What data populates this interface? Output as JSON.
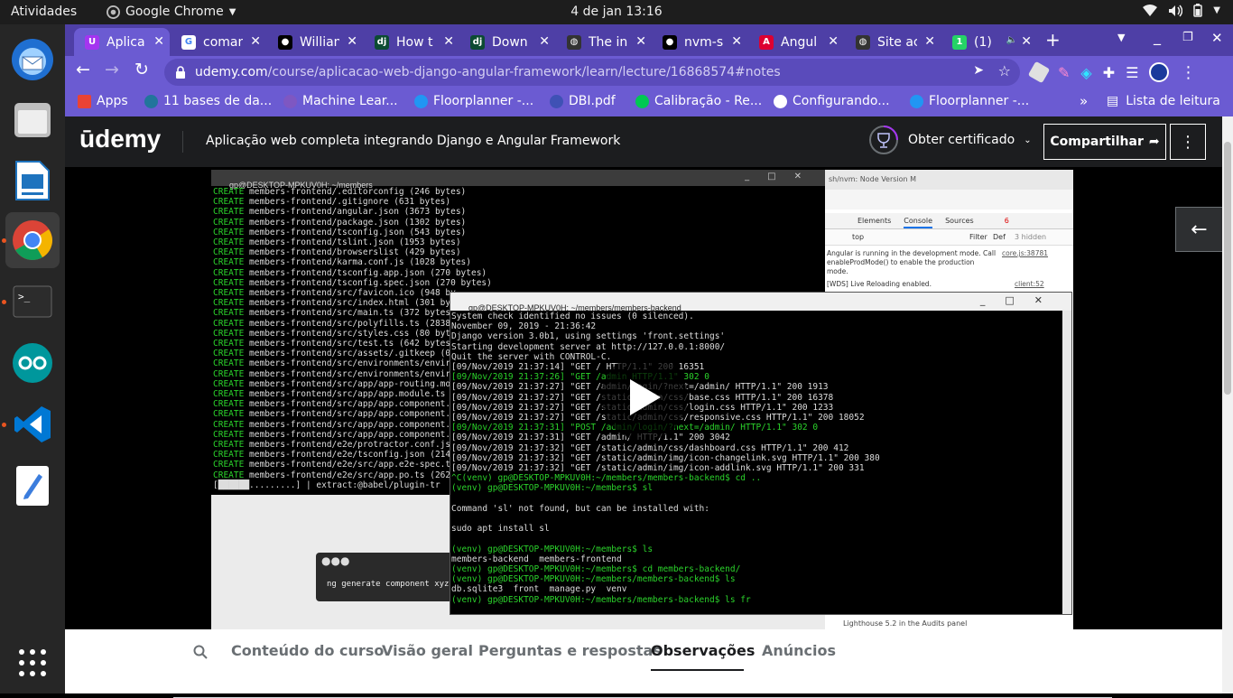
{
  "topbar": {
    "activities": "Atividades",
    "app_name": "Google Chrome",
    "clock": "4 de jan  13:16"
  },
  "tabs": [
    {
      "title": "Aplica",
      "color": "#a435f0",
      "glyph": "U"
    },
    {
      "title": "coman",
      "color": "#ffffff",
      "glyph": "G"
    },
    {
      "title": "Willian",
      "color": "#000000",
      "glyph": "●"
    },
    {
      "title": "How t",
      "color": "#0c4b33",
      "glyph": "dj"
    },
    {
      "title": "Down",
      "color": "#0c4b33",
      "glyph": "dj"
    },
    {
      "title": "The in",
      "color": "#333333",
      "glyph": "◍"
    },
    {
      "title": "nvm-s",
      "color": "#000000",
      "glyph": "●"
    },
    {
      "title": "Angul",
      "color": "#dd0031",
      "glyph": "A"
    },
    {
      "title": "Site ac",
      "color": "#333333",
      "glyph": "◍"
    },
    {
      "title": "(1)",
      "color": "#25d366",
      "glyph": "1"
    }
  ],
  "address": {
    "host": "udemy.com",
    "path": "/course/aplicacao-web-django-angular-framework/learn/lecture/16868574#notes"
  },
  "bookmarks": [
    {
      "label": "Apps",
      "color": "#ea4335"
    },
    {
      "label": "11 bases de da...",
      "color": "#21759b"
    },
    {
      "label": "Machine Lear...",
      "color": "#7e57c2"
    },
    {
      "label": "Floorplanner -...",
      "color": "#2196f3"
    },
    {
      "label": "DBI.pdf",
      "color": "#3f51b5"
    },
    {
      "label": "Calibração - Re...",
      "color": "#00c853"
    },
    {
      "label": "Configurando...",
      "color": "#ffffff"
    },
    {
      "label": "Floorplanner -...",
      "color": "#2196f3"
    }
  ],
  "reading_list": "Lista de leitura",
  "udemy": {
    "logo": "ūdemy",
    "course_title": "Aplicação web completa integrando Django e Angular Framework",
    "certificate": "Obter certificado",
    "share": "Compartilhar"
  },
  "video": {
    "term1_title": "gp@DESKTOP-MPKUV0H: ~/members",
    "term1_lines": [
      "members-frontend/.editorconfig (246 bytes)",
      "members-frontend/.gitignore (631 bytes)",
      "members-frontend/angular.json (3673 bytes)",
      "members-frontend/package.json (1302 bytes)",
      "members-frontend/tsconfig.json (543 bytes)",
      "members-frontend/tslint.json (1953 bytes)",
      "members-frontend/browserslist (429 bytes)",
      "members-frontend/karma.conf.js (1028 bytes)",
      "members-frontend/tsconfig.app.json (270 bytes)",
      "members-frontend/tsconfig.spec.json (270 bytes)",
      "members-frontend/src/favicon.ico (948 by",
      "members-frontend/src/index.html (301 byt",
      "members-frontend/src/main.ts (372 bytes)",
      "members-frontend/src/polyfills.ts (2838",
      "members-frontend/src/styles.css (80 byte",
      "members-frontend/src/test.ts (642 bytes)",
      "members-frontend/src/assets/.gitkeep (0",
      "members-frontend/src/environments/enviro",
      "members-frontend/src/environments/enviro",
      "members-frontend/src/app/app-routing.mod",
      "members-frontend/src/app/app.module.ts (",
      "members-frontend/src/app/app.component.c",
      "members-frontend/src/app/app.component.h",
      "members-frontend/src/app/app.component.s",
      "members-frontend/src/app/app.component.t",
      "members-frontend/e2e/protractor.conf.js",
      "members-frontend/e2e/tsconfig.json (214",
      "members-frontend/e2e/src/app.e2e-spec.ts",
      "members-frontend/e2e/src/app.po.ts (262"
    ],
    "term1_progress": "[██████.........] | extract:@babel/plugin-tr",
    "create_word": "CREATE",
    "term2_title": "gp@DESKTOP-MPKUV0H: ~/members/members-backend",
    "term2_lines": [
      "System check identified no issues (0 silenced).",
      "November 09, 2019 - 21:36:42",
      "Django version 3.0b1, using settings 'front.settings'",
      "Starting development server at http://127.0.0.1:8000/",
      "Quit the server with CONTROL-C.",
      "[09/Nov/2019 21:37:14] \"GET / HTTP/1.1\" 200 16351",
      "[09/Nov/2019 21:37:26] \"GET /admin HTTP/1.1\" 302 0",
      "[09/Nov/2019 21:37:27] \"GET /admin/login/?next=/admin/ HTTP/1.1\" 200 1913",
      "[09/Nov/2019 21:37:27] \"GET /static/admin/css/base.css HTTP/1.1\" 200 16378",
      "[09/Nov/2019 21:37:27] \"GET /static/admin/css/login.css HTTP/1.1\" 200 1233",
      "[09/Nov/2019 21:37:27] \"GET /static/admin/css/responsive.css HTTP/1.1\" 200 18052",
      "[09/Nov/2019 21:37:31] \"POST /admin/login/?next=/admin/ HTTP/1.1\" 302 0",
      "[09/Nov/2019 21:37:31] \"GET /admin/ HTTP/1.1\" 200 3042",
      "[09/Nov/2019 21:37:32] \"GET /static/admin/css/dashboard.css HTTP/1.1\" 200 412",
      "[09/Nov/2019 21:37:32] \"GET /static/admin/img/icon-changelink.svg HTTP/1.1\" 200 380",
      "[09/Nov/2019 21:37:32] \"GET /static/admin/img/icon-addlink.svg HTTP/1.1\" 200 331"
    ],
    "term2_cmds": [
      "^C(venv) gp@DESKTOP-MPKUV0H:~/members/members-backend$ cd ..",
      "(venv) gp@DESKTOP-MPKUV0H:~/members$ sl",
      "",
      "Command 'sl' not found, but can be installed with:",
      "",
      "sudo apt install sl",
      "",
      "(venv) gp@DESKTOP-MPKUV0H:~/members$ ls",
      "members-backend  members-frontend",
      "(venv) gp@DESKTOP-MPKUV0H:~/members$ cd members-backend/",
      "(venv) gp@DESKTOP-MPKUV0H:~/members/members-backend$ ls",
      "db.sqlite3  front  manage.py  venv",
      "(venv) gp@DESKTOP-MPKUV0H:~/members/members-backend$ ls fr"
    ],
    "ng_command": "ng generate component xyz",
    "devtools_title": "sh/nvm: Node Version M",
    "devtools_tabs": [
      "Elements",
      "Console",
      "Sources"
    ],
    "devtools_top": "top",
    "devtools_filter": "Filter",
    "devtools_def": "Def",
    "devtools_hidden": "3 hidden",
    "devtools_error_count": "6",
    "devtools_msg1": "Angular is running in the development mode. Call enableProdMode() to enable the production mode.",
    "devtools_src1": "core.js:38781",
    "devtools_msg2": "[WDS] Live Reloading enabled.",
    "devtools_src2": "client:52",
    "devtools_footer": "Lighthouse 5.2 in the Audits panel"
  },
  "page_tabs": [
    "Conteúdo do curso",
    "Visão geral",
    "Perguntas e respostas",
    "Observações",
    "Anúncios"
  ],
  "active_page_tab": "Observações"
}
